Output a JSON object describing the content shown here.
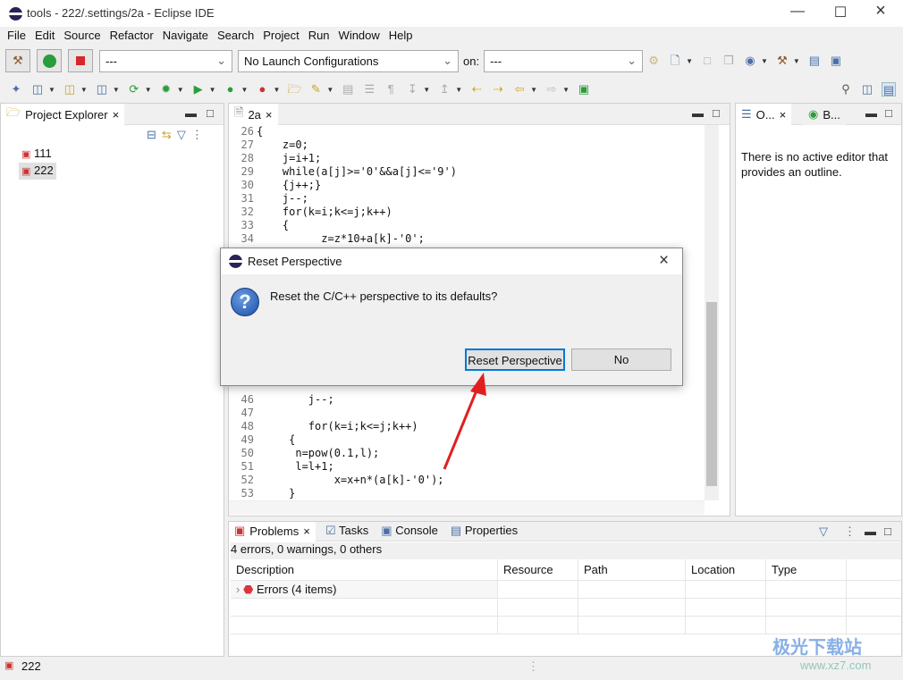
{
  "window": {
    "title": "tools - 222/.settings/2a - Eclipse IDE",
    "controls": [
      "minimize",
      "maximize",
      "close"
    ]
  },
  "menu": [
    "File",
    "Edit",
    "Source",
    "Refactor",
    "Navigate",
    "Search",
    "Project",
    "Run",
    "Window",
    "Help"
  ],
  "toolbar": {
    "build_config": "---",
    "launch_config": "No Launch Configurations",
    "on_label": "on:",
    "launch_target": "---"
  },
  "project_explorer": {
    "tab": "Project Explorer",
    "projects": [
      {
        "name": "111"
      },
      {
        "name": "222",
        "selected": true
      }
    ]
  },
  "editor": {
    "tab": "2a",
    "lines": [
      {
        "n": "26",
        "t": "{"
      },
      {
        "n": "27",
        "t": "    z=0;"
      },
      {
        "n": "28",
        "t": "    j=i+1;"
      },
      {
        "n": "29",
        "t": "    while(a[j]>='0'&&a[j]<='9')"
      },
      {
        "n": "30",
        "t": "    {j++;}"
      },
      {
        "n": "31",
        "t": "    j--;"
      },
      {
        "n": "32",
        "t": "    for(k=i;k<=j;k++)"
      },
      {
        "n": "33",
        "t": "    {"
      },
      {
        "n": "34",
        "t": "          z=z*10+a[k]-'0';"
      }
    ],
    "lines_bottom": [
      {
        "n": "46",
        "t": "        j--;"
      },
      {
        "n": "47",
        "t": ""
      },
      {
        "n": "48",
        "t": "        for(k=i;k<=j;k++)"
      },
      {
        "n": "49",
        "t": "     {"
      },
      {
        "n": "50",
        "t": "      n=pow(0.1,l);"
      },
      {
        "n": "51",
        "t": "      l=l+1;"
      },
      {
        "n": "52",
        "t": "            x=x+n*(a[k]-'0');"
      },
      {
        "n": "53",
        "t": "     }"
      }
    ]
  },
  "outline": {
    "tab1": "O...",
    "tab2": "B...",
    "message": "There is no active editor that provides an outline."
  },
  "bottom": {
    "tabs": [
      "Problems",
      "Tasks",
      "Console",
      "Properties"
    ],
    "summary": "4 errors, 0 warnings, 0 others",
    "columns": [
      "Description",
      "Resource",
      "Path",
      "Location",
      "Type"
    ],
    "rows": [
      {
        "description": "Errors (4 items)"
      }
    ]
  },
  "status": {
    "selection": "222"
  },
  "dialog": {
    "title": "Reset Perspective",
    "message": "Reset the C/C++ perspective to its defaults?",
    "primary": "Reset Perspective",
    "secondary": "No",
    "close": "×"
  },
  "watermark": {
    "text": "极光下载站",
    "url": "www.xz7.com"
  },
  "colors": {
    "accent": "#0078d7",
    "arrow": "#e02020",
    "error": "#d9363e"
  }
}
